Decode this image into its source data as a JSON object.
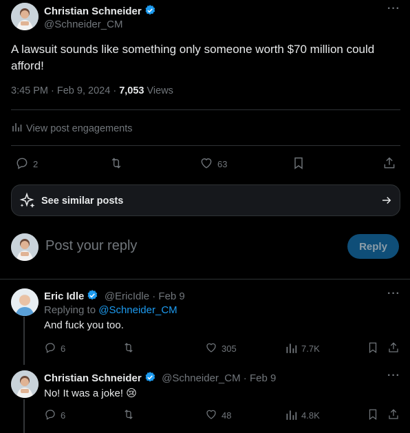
{
  "main_post": {
    "author_name": "Christian Schneider",
    "author_handle": "@Schneider_CM",
    "text": "A lawsuit sounds like something only someone worth $70 million could afford!",
    "time": "3:45 PM",
    "date": "Feb 9, 2024",
    "views_count": "7,053",
    "views_label": "Views",
    "engagements_label": "View post engagements",
    "replies_count": "2",
    "likes_count": "63"
  },
  "similar_posts": {
    "label": "See similar posts"
  },
  "reply_composer": {
    "placeholder": "Post your reply",
    "button_label": "Reply"
  },
  "replies": [
    {
      "author_name": "Eric Idle",
      "author_handle": "@EricIdle",
      "date": "Feb 9",
      "replying_to_label": "Replying to",
      "replying_to_handle": "@Schneider_CM",
      "text": "And fuck you too.",
      "replies_count": "6",
      "likes_count": "305",
      "views_count": "7.7K"
    },
    {
      "author_name": "Christian Schneider",
      "author_handle": "@Schneider_CM",
      "date": "Feb 9",
      "text": "No! It was a joke! 😢",
      "replies_count": "6",
      "likes_count": "48",
      "views_count": "4.8K"
    }
  ],
  "colors": {
    "accent": "#1d9bf0",
    "muted": "#71767b",
    "reply_button_bg": "#0f4e78"
  }
}
